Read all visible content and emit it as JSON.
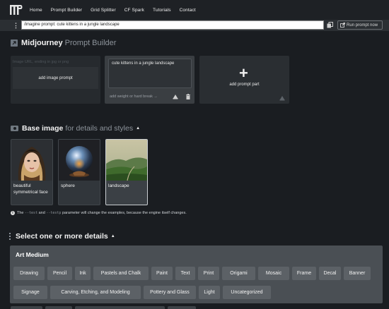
{
  "nav": {
    "items": [
      "Home",
      "Prompt Builder",
      "Grid Splitter",
      "CF Spark",
      "Tutorials",
      "Contact"
    ]
  },
  "prompt_bar": {
    "value": "/imagine prompt: cute kittens in a jungle landscape",
    "run_label": "Run prompt now"
  },
  "title": {
    "main": "Midjourney",
    "sub": "Prompt Builder"
  },
  "cards": {
    "image_url_placeholder": "Image URL, ending in jpg or png",
    "add_image_prompt": "add image prompt",
    "text_prompt_value": "cute kittens in a jungle landscape",
    "weight_placeholder": "add weight or hard break →",
    "add_prompt_part": "add prompt part"
  },
  "base_image": {
    "title": "Base image",
    "subtitle": "for details and styles",
    "items": [
      {
        "caption": "beautiful symmetrical face",
        "selected": false
      },
      {
        "caption": "sphere",
        "selected": false
      },
      {
        "caption": "landscape",
        "selected": true
      }
    ],
    "note_prefix": "The",
    "note_code1": "--test",
    "note_and": "and",
    "note_code2": "--testp",
    "note_suffix": "parameter will change the examples, because the engine itself changes."
  },
  "details": {
    "title": "Select one or more details",
    "panel_title": "Art Medium",
    "chips_row1": [
      "Drawing",
      "Pencil",
      "Ink",
      "Pastels and Chalk",
      "Paint",
      "Text",
      "Print",
      "Origami",
      "Mosaic",
      "Frame",
      "Decal",
      "Banner"
    ],
    "chips_row2": [
      "Signage",
      "Carving, Etching, and Modeling",
      "Pottery and Glass",
      "Light",
      "Uncategorized"
    ]
  },
  "colors": {
    "background": "#1a1d21",
    "panel": "#4a4f54",
    "chip": "#5c6166"
  }
}
